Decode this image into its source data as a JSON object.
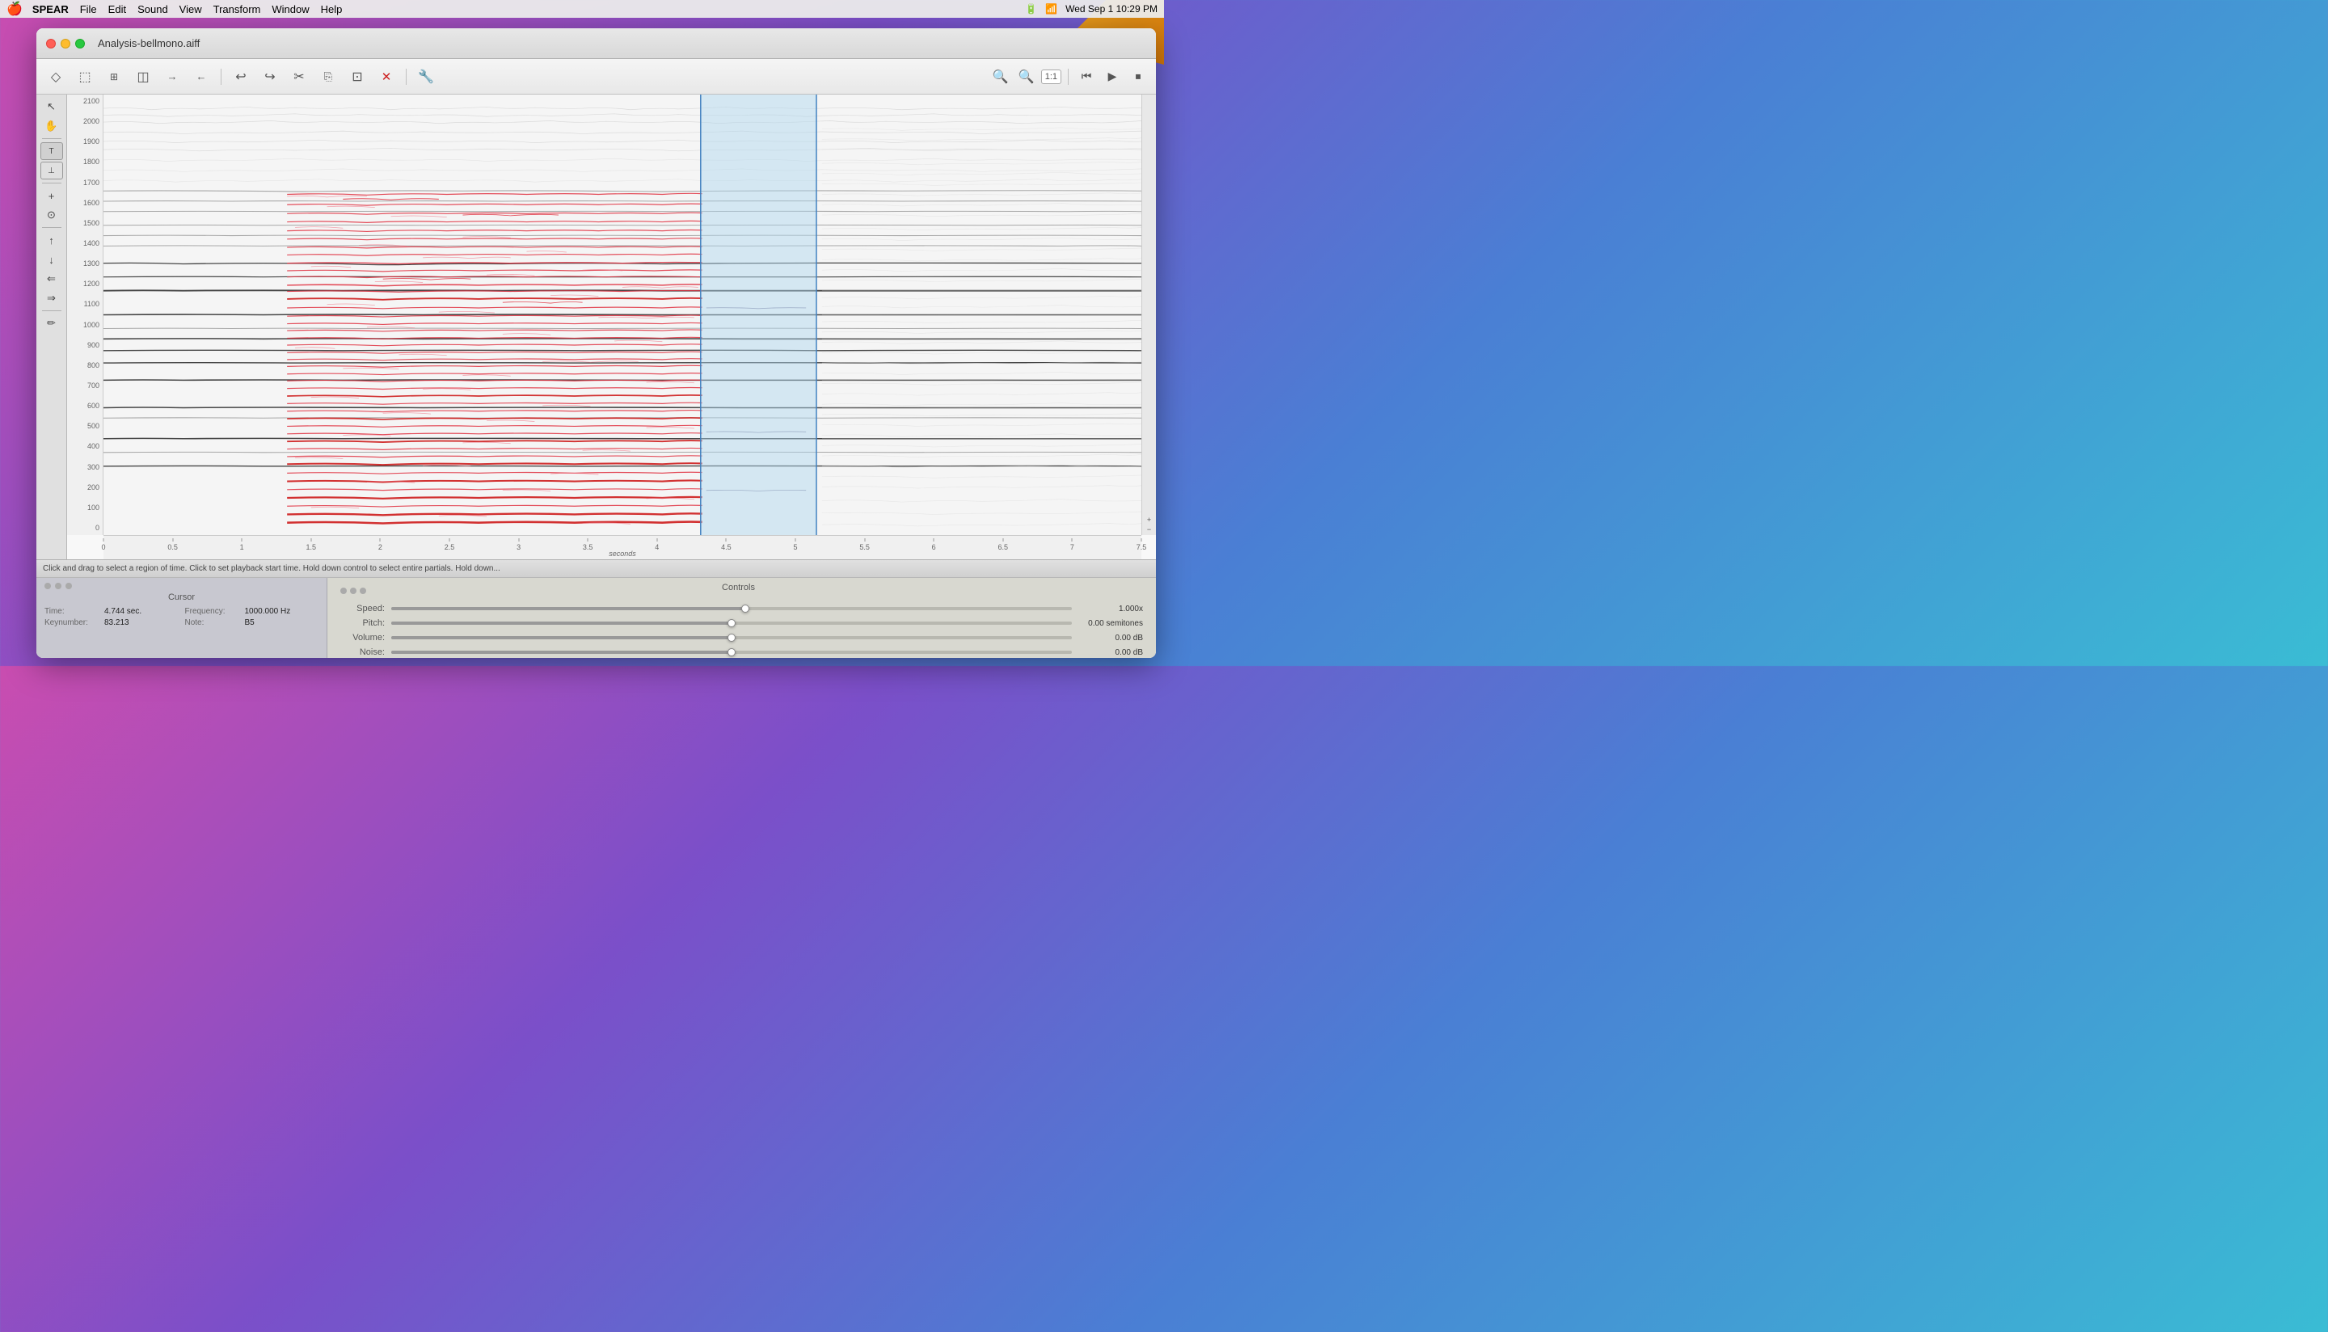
{
  "menubar": {
    "apple": "🍎",
    "items": [
      {
        "label": "SPEAR",
        "bold": true
      },
      {
        "label": "File"
      },
      {
        "label": "Edit"
      },
      {
        "label": "Sound"
      },
      {
        "label": "View"
      },
      {
        "label": "Transform"
      },
      {
        "label": "Window"
      },
      {
        "label": "Help"
      }
    ],
    "right": {
      "battery": "⚡",
      "wifi": "WiFi",
      "datetime": "Wed Sep 1  10:29 PM"
    }
  },
  "window": {
    "title": "Analysis-bellmono.aiff",
    "traffic": [
      "red",
      "yellow",
      "green"
    ]
  },
  "toolbar": {
    "buttons": [
      {
        "icon": "◇",
        "name": "new-file-btn"
      },
      {
        "icon": "□",
        "name": "open-btn"
      },
      {
        "icon": "▦",
        "name": "save-btn"
      },
      {
        "icon": "◫",
        "name": "export-btn"
      },
      {
        "icon": "→|",
        "name": "import-btn"
      },
      {
        "icon": "|→",
        "name": "export2-btn"
      },
      {
        "icon": "↩",
        "name": "undo-btn"
      },
      {
        "icon": "↪",
        "name": "redo-btn"
      },
      {
        "icon": "✂",
        "name": "cut-btn"
      },
      {
        "icon": "⎘",
        "name": "copy-btn"
      },
      {
        "icon": "⊡",
        "name": "paste-btn"
      },
      {
        "icon": "✖",
        "name": "delete-btn",
        "color": "#cc2020"
      },
      {
        "icon": "🔧",
        "name": "tools-btn"
      }
    ],
    "zoom": {
      "minus": "−",
      "plus": "+",
      "ratio": "1:1"
    },
    "transport": {
      "rewind": "⏮",
      "play": "▶",
      "stop": "⏹"
    }
  },
  "tools": [
    {
      "icon": "↖",
      "name": "pointer-tool",
      "active": false
    },
    {
      "icon": "✋",
      "name": "hand-tool",
      "active": false
    },
    {
      "icon": "⊤",
      "name": "select-tool",
      "active": false
    },
    {
      "icon": "⊥",
      "name": "split-tool",
      "active": false
    },
    {
      "icon": "+",
      "name": "add-tool"
    },
    {
      "icon": "⊙",
      "name": "lasso-tool"
    },
    {
      "icon": "↕",
      "name": "move-v-tool"
    },
    {
      "icon": "↕",
      "name": "move-v2-tool"
    },
    {
      "icon": "↔",
      "name": "move-h-tool"
    },
    {
      "icon": "↔",
      "name": "move-h2-tool"
    },
    {
      "icon": "⇐",
      "name": "left-tool"
    },
    {
      "icon": "⇒",
      "name": "right-tool"
    },
    {
      "icon": "✏",
      "name": "draw-tool"
    }
  ],
  "yaxis": {
    "labels": [
      "2100",
      "2000",
      "1900",
      "1800",
      "1700",
      "1600",
      "1500",
      "1400",
      "1300",
      "1200",
      "1100",
      "1000",
      "900",
      "800",
      "700",
      "600",
      "500",
      "400",
      "300",
      "200",
      "100",
      "0"
    ]
  },
  "xaxis": {
    "ticks": [
      "0",
      "0.5",
      "1",
      "1.5",
      "2",
      "2.5",
      "3",
      "3.5",
      "4",
      "4.5",
      "5",
      "5.5",
      "6",
      "6.5",
      "7",
      "7.5"
    ],
    "label": "seconds"
  },
  "selection": {
    "start_pct": 57.5,
    "end_pct": 69.0
  },
  "playhead": {
    "pct": 57.5
  },
  "status": {
    "message": "Click and drag to select a region of time. Click to set playback start time. Hold down control to select entire partials. Hold down..."
  },
  "cursor_panel": {
    "title": "Cursor",
    "fields": [
      {
        "label": "Time:",
        "value": "4.744 sec.",
        "key": "time"
      },
      {
        "label": "Frequency:",
        "value": "1000.000 Hz",
        "key": "frequency"
      },
      {
        "label": "Keynumber:",
        "value": "83.213",
        "key": "keynumber"
      },
      {
        "label": "Note:",
        "value": "B5",
        "key": "note"
      }
    ]
  },
  "controls_panel": {
    "title": "Controls",
    "sliders": [
      {
        "label": "Speed:",
        "value": "1.000x",
        "pct": 52,
        "key": "speed"
      },
      {
        "label": "Pitch:",
        "value": "0.00 semitones",
        "pct": 50,
        "key": "pitch"
      },
      {
        "label": "Volume:",
        "value": "0.00 dB",
        "pct": 50,
        "key": "volume"
      },
      {
        "label": "Noise:",
        "value": "0.00 dB",
        "pct": 50,
        "key": "noise"
      }
    ]
  }
}
